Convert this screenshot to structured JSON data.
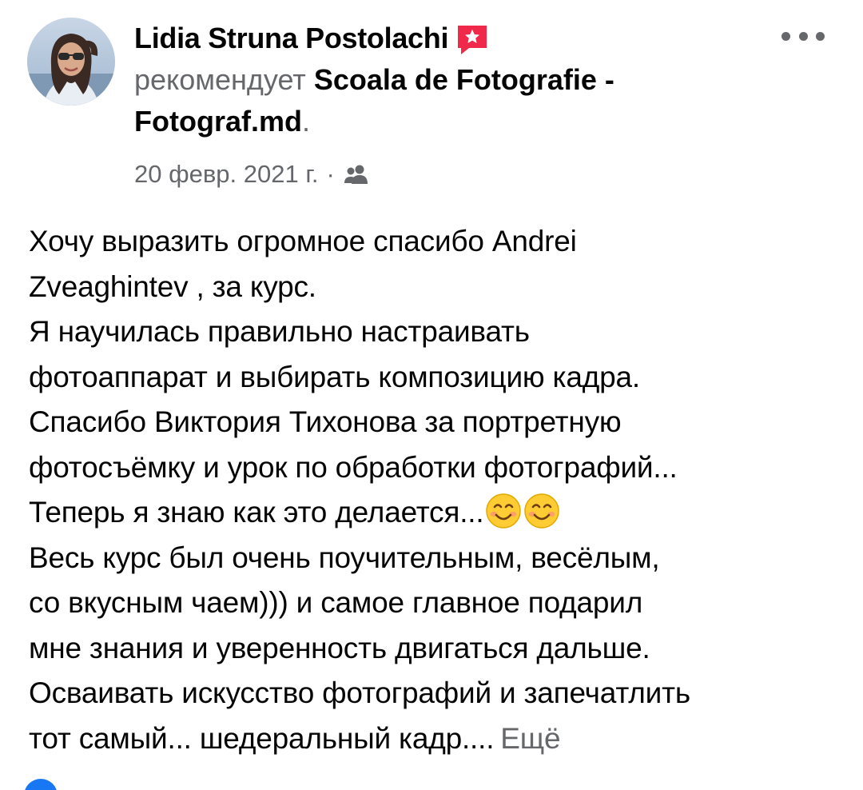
{
  "author": {
    "name": "Lidia Struna Postolachi",
    "badge_icon": "recommend-flag-icon"
  },
  "recommendation": {
    "verb": "рекомендует",
    "page_name_line1": "Scoala de Fotografie -",
    "page_name_line2": "Fotograf.md",
    "trailing": "."
  },
  "meta": {
    "date": "20 февр. 2021 г.",
    "separator": "·",
    "audience_icon": "friends-icon"
  },
  "post_text": {
    "lines": [
      "Хочу выразить огромное спасибо Andrei",
      "Zveaghintev , за курс.",
      "Я научилась правильно настраивать",
      "фотоаппарат и выбирать композицию кадра.",
      "Спасибо Виктория Тихонова за портретную",
      "фотосъёмку и урок по обработки фотографий...",
      "Теперь я знаю как это делается...",
      "Весь курс был очень поучительным, весёлым,",
      "со вкусным чаем))) и самое главное подарил",
      "мне знания и уверенность двигаться дальше.",
      "Осваивать искусство фотографий и запечатлить",
      "тот самый... шедеральный кадр...."
    ],
    "emoji": "smiling-face-emoji",
    "see_more": "Ещё"
  },
  "colors": {
    "text_primary": "#050505",
    "text_secondary": "#65676b",
    "badge_red": "#f02849",
    "accent_blue": "#1877f2"
  }
}
